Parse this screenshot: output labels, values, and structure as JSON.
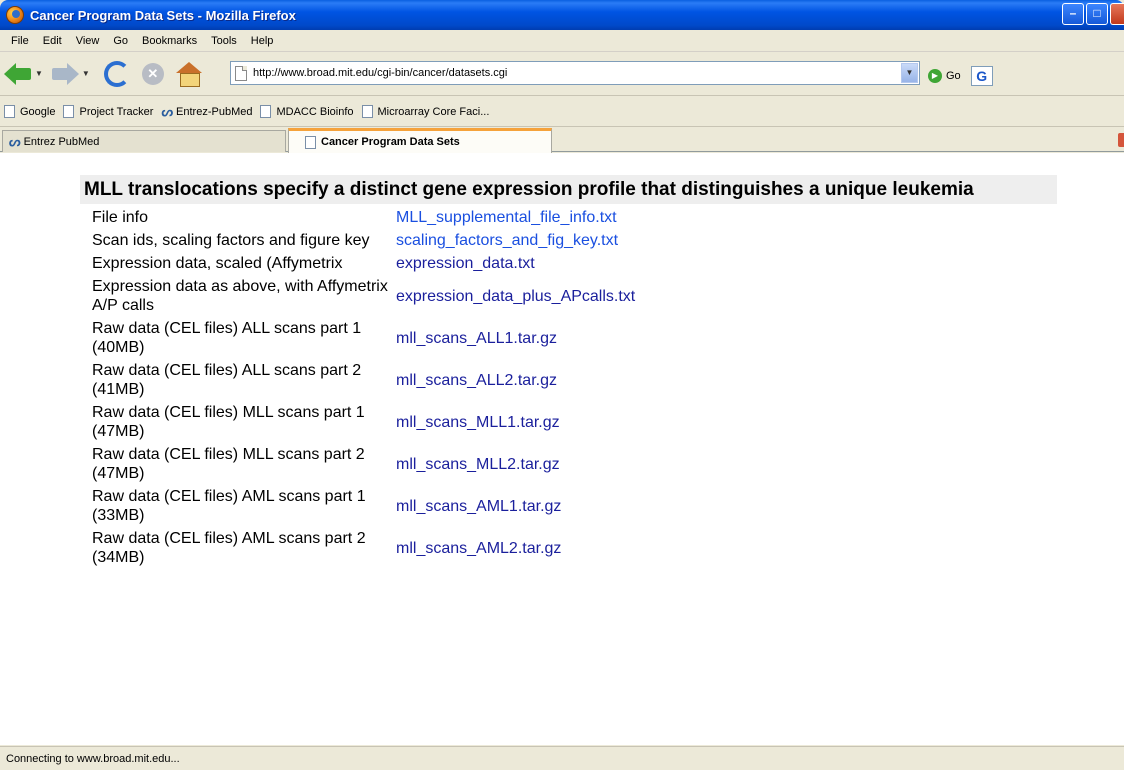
{
  "window": {
    "title": "Cancer Program Data Sets - Mozilla Firefox"
  },
  "menu": {
    "items": [
      "File",
      "Edit",
      "View",
      "Go",
      "Bookmarks",
      "Tools",
      "Help"
    ]
  },
  "nav": {
    "url": "http://www.broad.mit.edu/cgi-bin/cancer/datasets.cgi",
    "go_label": "Go",
    "google_letter": "G"
  },
  "bookmarks": {
    "items": [
      "Google",
      "Project Tracker",
      "Entrez-PubMed",
      "MDACC Bioinfo",
      "Microarray Core Faci..."
    ]
  },
  "tabs": [
    {
      "label": "Entrez PubMed",
      "active": false
    },
    {
      "label": "Cancer Program Data Sets",
      "active": true
    }
  ],
  "page": {
    "heading": "MLL translocations specify a distinct gene expression profile that distinguishes a unique leukemia",
    "rows": [
      {
        "label": "File info",
        "link": "MLL_supplemental_file_info.txt"
      },
      {
        "label": "Scan ids, scaling factors and figure key",
        "link": "scaling_factors_and_fig_key.txt"
      },
      {
        "label": "Expression data, scaled (Affymetrix",
        "link": "expression_data.txt"
      },
      {
        "label": "Expression data as above, with Affymetrix A/P calls",
        "link": "expression_data_plus_APcalls.txt"
      },
      {
        "label": "Raw data (CEL files) ALL scans part 1 (40MB)",
        "link": "mll_scans_ALL1.tar.gz"
      },
      {
        "label": "Raw data (CEL files) ALL scans part 2 (41MB)",
        "link": "mll_scans_ALL2.tar.gz"
      },
      {
        "label": "Raw data (CEL files) MLL scans part 1 (47MB)",
        "link": "mll_scans_MLL1.tar.gz"
      },
      {
        "label": "Raw data (CEL files) MLL scans part 2 (47MB)",
        "link": "mll_scans_MLL2.tar.gz"
      },
      {
        "label": "Raw data (CEL files) AML scans part 1 (33MB)",
        "link": "mll_scans_AML1.tar.gz"
      },
      {
        "label": "Raw data (CEL files) AML scans part 2 (34MB)",
        "link": "mll_scans_AML2.tar.gz"
      }
    ]
  },
  "status": {
    "text": "Connecting to www.broad.mit.edu..."
  },
  "colors": {
    "title_bar": "#0054e3",
    "link_blue": "#1a4fe0",
    "link_dark": "#1a1f9c",
    "heading_bg": "#eeeeee",
    "active_tab_accent": "#f5a23b"
  }
}
